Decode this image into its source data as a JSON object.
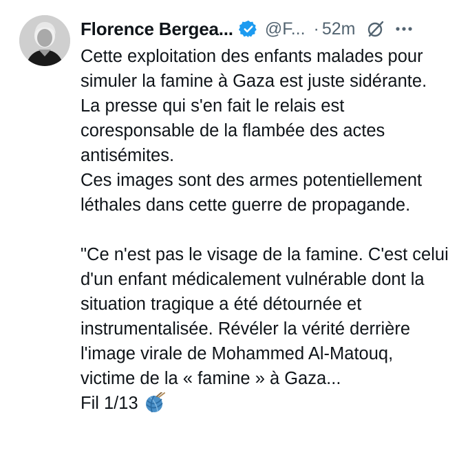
{
  "author": {
    "name": "Florence Bergea...",
    "handle": "@F...",
    "separator": "·",
    "time": "52m",
    "verified_color": "#1d9bf0"
  },
  "icons": {
    "avatar": "profile-photo",
    "verified": "verified-badge-icon",
    "grok": "grok-icon",
    "more": "more-dots-icon",
    "thread": "yarn-ball-emoji"
  },
  "post": {
    "paragraph1": "Cette exploitation des enfants malades pour simuler la famine à Gaza est juste sidérante.",
    "paragraph2": "La presse qui s'en fait le relais est coresponsable de la flambée des actes antisémites.",
    "paragraph3": "Ces images sont des armes potentiellement léthales dans cette guerre de propagande.",
    "quote": "\"Ce n'est pas le visage de la famine. C'est celui d'un enfant médicalement vulnérable dont la situation tragique a été détournée et instrumentalisée.  Révéler la vérité derrière l'image virale de Mohammed Al-Matouq, victime de la « famine » à Gaza...",
    "thread_label": "Fil 1/13"
  },
  "colors": {
    "text": "#0f1419",
    "secondary": "#536471",
    "accent": "#1d9bf0"
  }
}
